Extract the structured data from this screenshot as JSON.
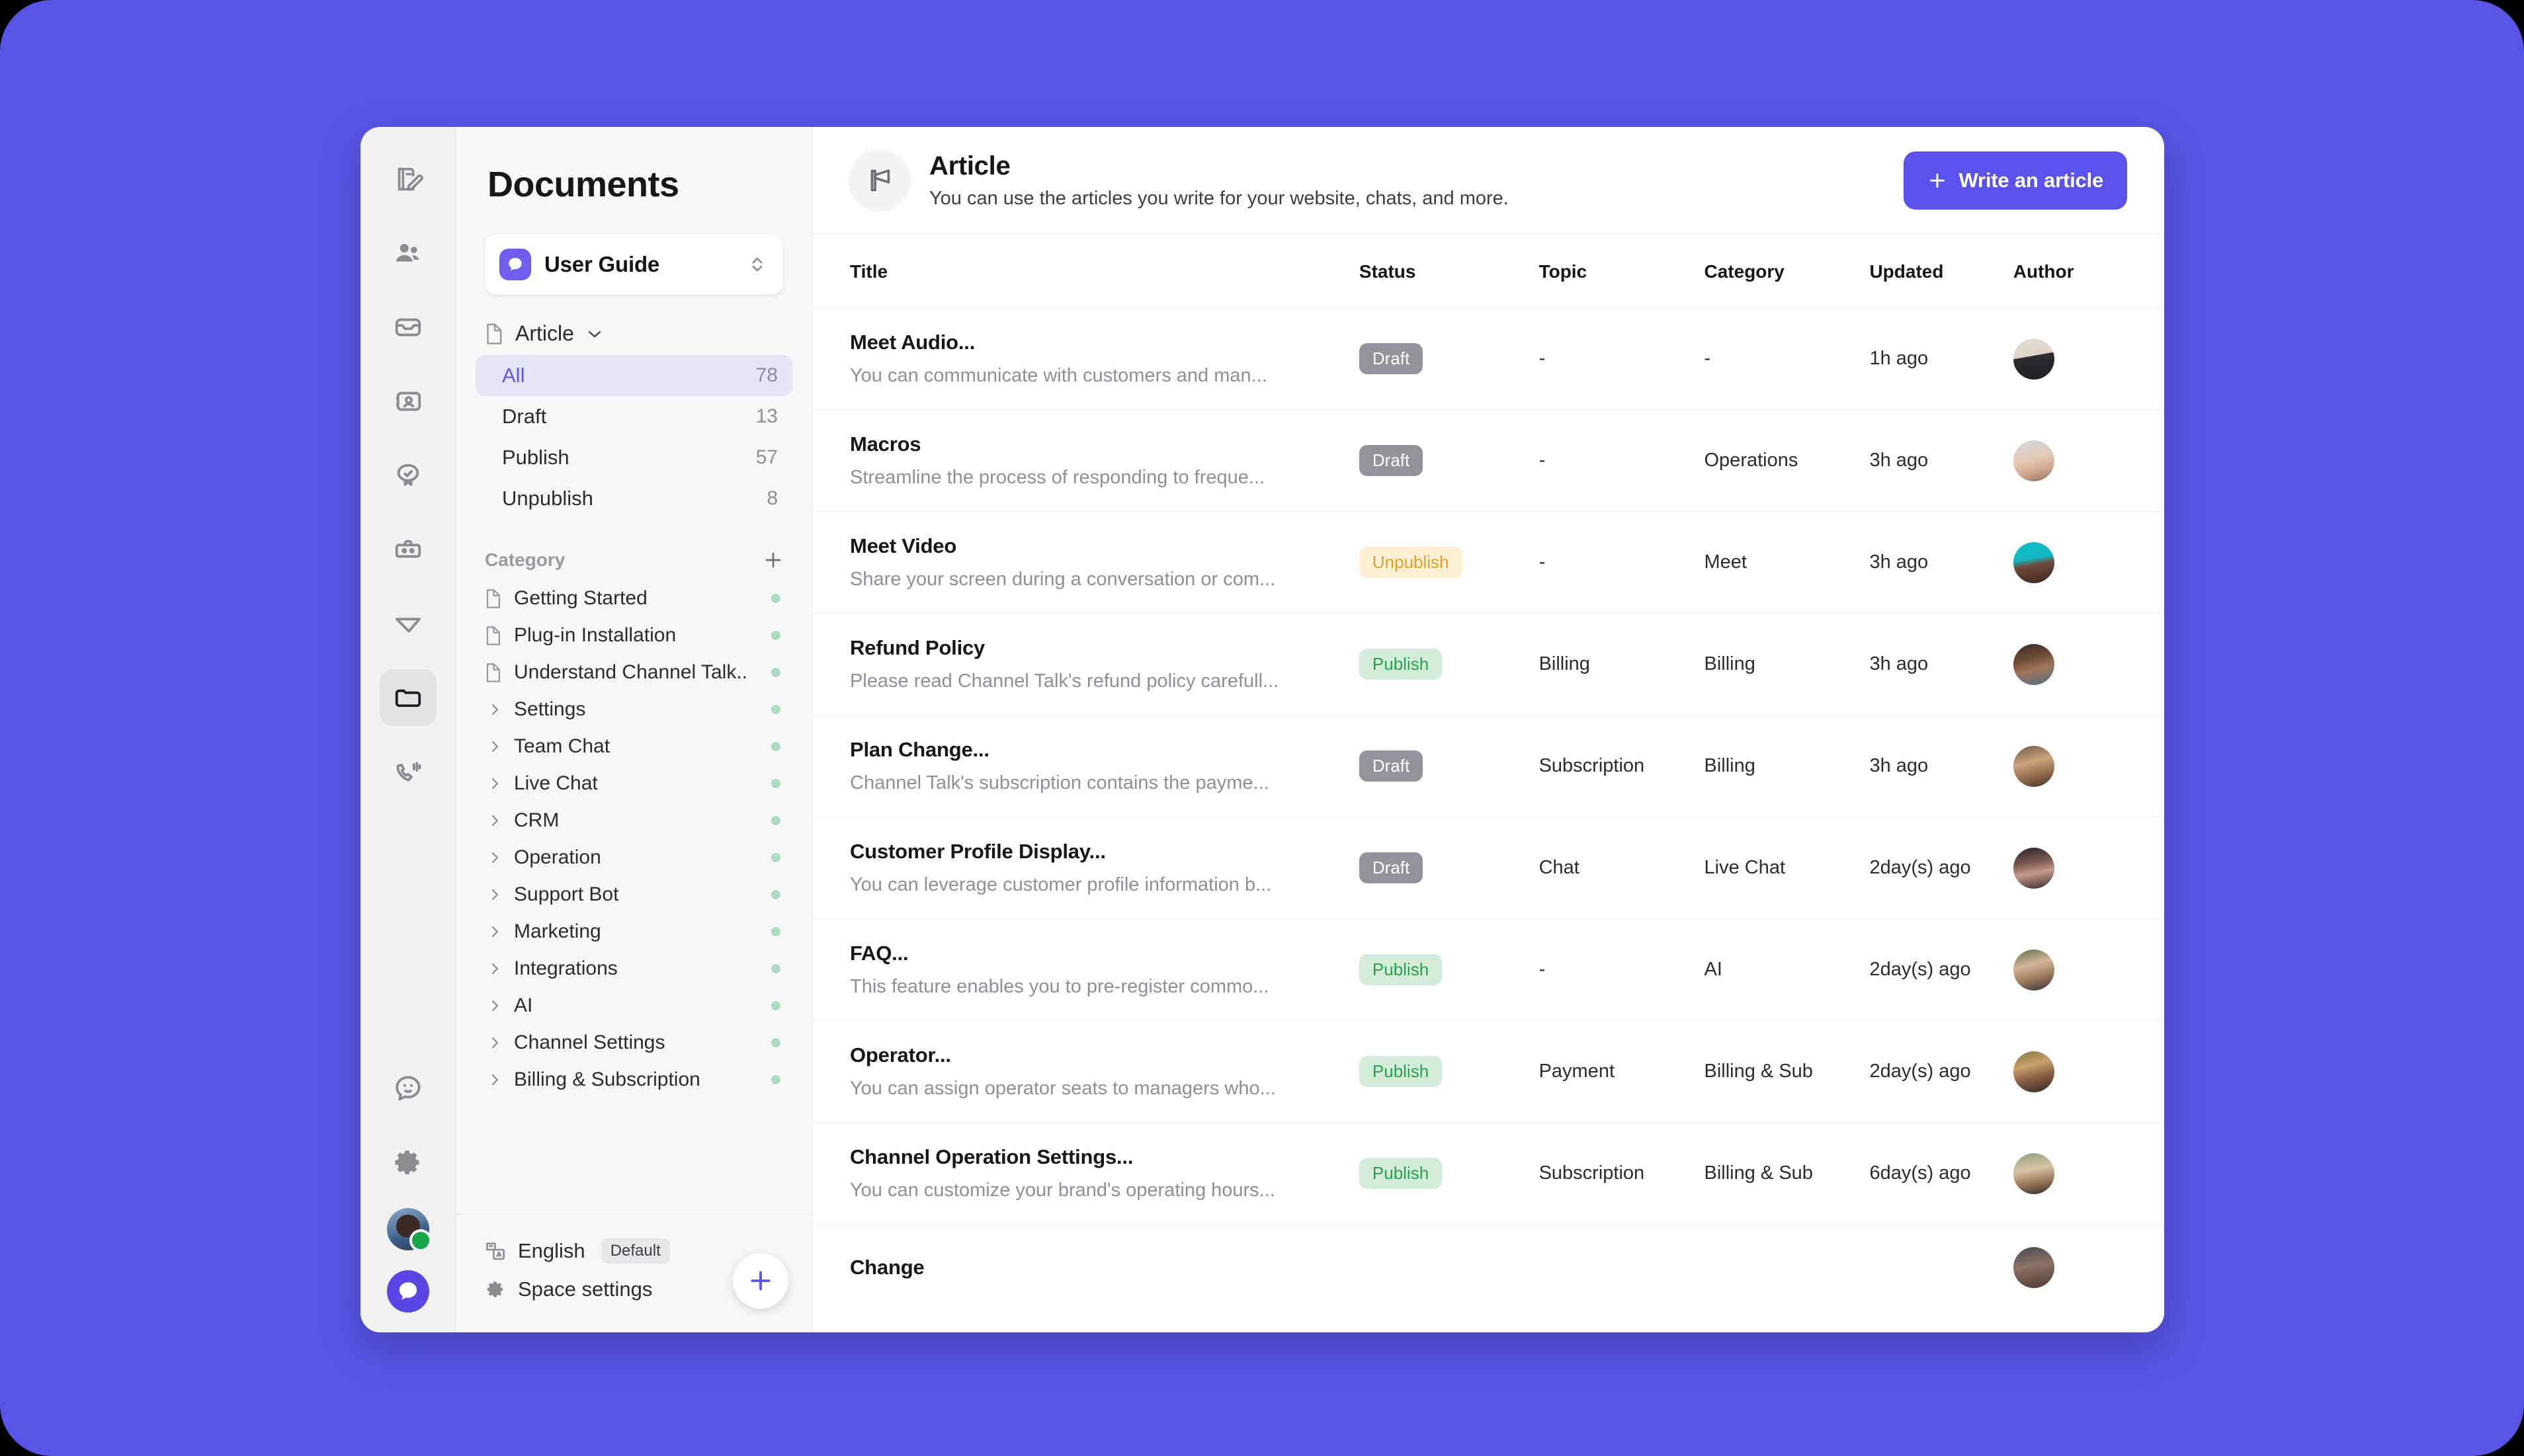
{
  "theme": {
    "background": "#5855e6",
    "accent": "#5b52ee",
    "card": "#ffffff"
  },
  "rail": {
    "items": [
      {
        "name": "documents-write-icon",
        "label": "Write"
      },
      {
        "name": "team-icon",
        "label": "Team"
      },
      {
        "name": "inbox-icon",
        "label": "Inbox"
      },
      {
        "name": "contacts-icon",
        "label": "Contacts"
      },
      {
        "name": "badge-check-icon",
        "label": "Verified"
      },
      {
        "name": "toolbox-icon",
        "label": "Toolbox"
      },
      {
        "name": "send-icon",
        "label": "Send"
      },
      {
        "name": "folder-icon",
        "label": "Documents"
      },
      {
        "name": "call-icon",
        "label": "Calls"
      }
    ],
    "bottom": [
      {
        "name": "chat-face-icon",
        "label": "Chat"
      },
      {
        "name": "gear-icon",
        "label": "Settings"
      }
    ]
  },
  "sidebar": {
    "title": "Documents",
    "space": {
      "name": "User Guide"
    },
    "section": {
      "label": "Article"
    },
    "filters": [
      {
        "label": "All",
        "count": "78",
        "selected": true
      },
      {
        "label": "Draft",
        "count": "13",
        "selected": false
      },
      {
        "label": "Publish",
        "count": "57",
        "selected": false
      },
      {
        "label": "Unpublish",
        "count": "8",
        "selected": false
      }
    ],
    "category_header": "Category",
    "categories": [
      {
        "label": "Getting Started",
        "type": "doc"
      },
      {
        "label": "Plug-in Installation",
        "type": "doc"
      },
      {
        "label": "Understand Channel Talk..",
        "type": "doc"
      },
      {
        "label": "Settings",
        "type": "group"
      },
      {
        "label": "Team Chat",
        "type": "group"
      },
      {
        "label": "Live Chat",
        "type": "group"
      },
      {
        "label": "CRM",
        "type": "group"
      },
      {
        "label": "Operation",
        "type": "group"
      },
      {
        "label": "Support Bot",
        "type": "group"
      },
      {
        "label": "Marketing",
        "type": "group"
      },
      {
        "label": "Integrations",
        "type": "group"
      },
      {
        "label": "AI",
        "type": "group"
      },
      {
        "label": "Channel Settings",
        "type": "group"
      },
      {
        "label": "Billing & Subscription",
        "type": "group"
      }
    ],
    "footer": {
      "language": "English",
      "language_badge": "Default",
      "space_settings": "Space settings"
    }
  },
  "main": {
    "header": {
      "title": "Article",
      "subtitle": "You can use the articles you write for your website, chats, and more.",
      "write_button": "Write an article"
    },
    "table": {
      "columns": [
        "Title",
        "Status",
        "Topic",
        "Category",
        "Updated",
        "Author"
      ],
      "rows": [
        {
          "title": "Meet Audio...",
          "desc": "You can communicate with customers and man...",
          "status": "Draft",
          "status_kind": "draft",
          "topic": "-",
          "category": "-",
          "updated": "1h ago",
          "avatar": "av1"
        },
        {
          "title": "Macros",
          "desc": "Streamline the process of responding to freque...",
          "status": "Draft",
          "status_kind": "draft",
          "topic": "-",
          "category": "Operations",
          "updated": "3h ago",
          "avatar": "av2"
        },
        {
          "title": "Meet Video",
          "desc": "Share your screen during a conversation or com...",
          "status": "Unpublish",
          "status_kind": "unpublish",
          "topic": "-",
          "category": "Meet",
          "updated": "3h ago",
          "avatar": "av3"
        },
        {
          "title": "Refund Policy",
          "desc": "Please read Channel Talk's refund policy carefull...",
          "status": "Publish",
          "status_kind": "publish",
          "topic": "Billing",
          "category": "Billing",
          "updated": "3h ago",
          "avatar": "av4"
        },
        {
          "title": "Plan Change...",
          "desc": "Channel Talk's subscription contains the payme...",
          "status": "Draft",
          "status_kind": "draft",
          "topic": "Subscription",
          "category": "Billing",
          "updated": "3h ago",
          "avatar": "av5"
        },
        {
          "title": "Customer Profile Display...",
          "desc": "You can leverage customer profile information b...",
          "status": "Draft",
          "status_kind": "draft",
          "topic": "Chat",
          "category": "Live Chat",
          "updated": "2day(s) ago",
          "avatar": "av6"
        },
        {
          "title": "FAQ...",
          "desc": "This feature enables you to pre-register commo...",
          "status": "Publish",
          "status_kind": "publish",
          "topic": "-",
          "category": "AI",
          "updated": "2day(s) ago",
          "avatar": "av7"
        },
        {
          "title": "Operator...",
          "desc": "You can assign operator seats to managers who...",
          "status": "Publish",
          "status_kind": "publish",
          "topic": "Payment",
          "category": "Billing & Sub",
          "updated": "2day(s) ago",
          "avatar": "av8"
        },
        {
          "title": "Channel Operation Settings...",
          "desc": "You can customize your brand's operating hours...",
          "status": "Publish",
          "status_kind": "publish",
          "topic": "Subscription",
          "category": "Billing & Sub",
          "updated": "6day(s) ago",
          "avatar": "av9"
        },
        {
          "title": "Change",
          "desc": "",
          "status": "",
          "status_kind": "",
          "topic": "",
          "category": "",
          "updated": "",
          "avatar": "av10",
          "partial": true
        }
      ]
    }
  }
}
